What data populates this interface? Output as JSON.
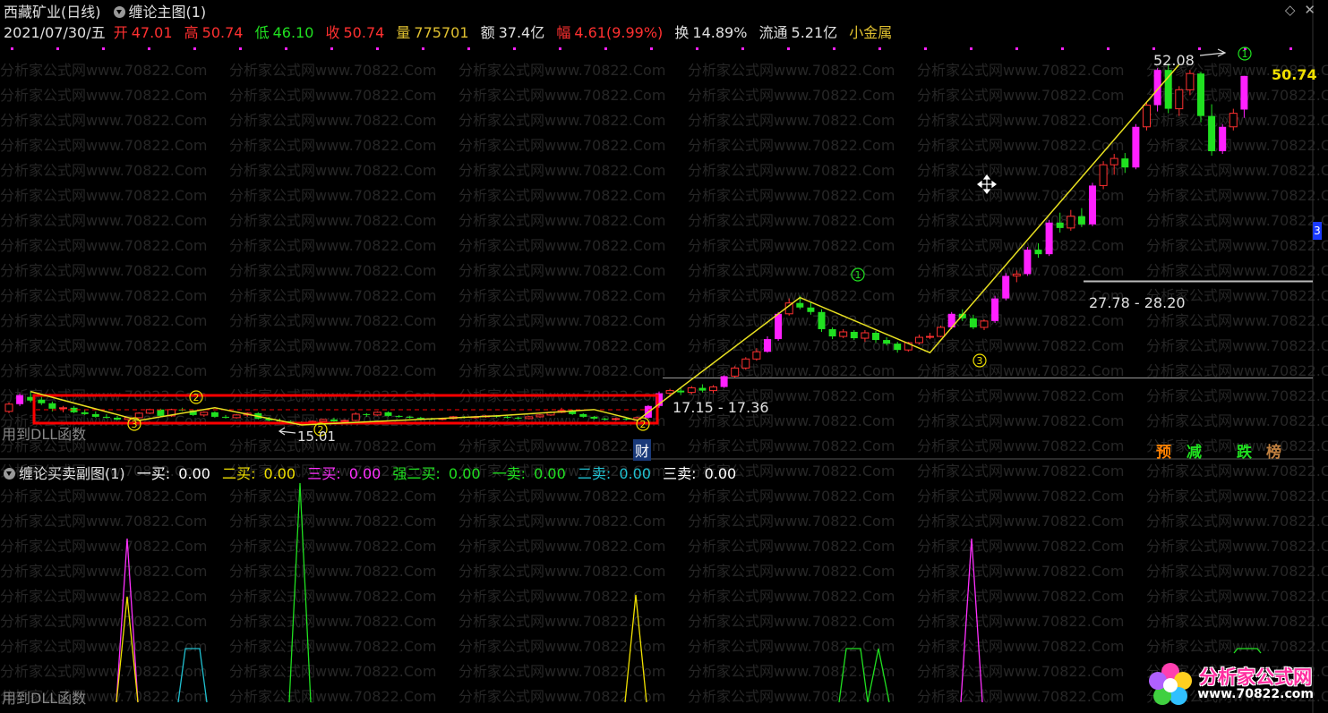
{
  "header": {
    "stock_name": "西藏矿业(日线)",
    "indicator_name": "缠论主图(1)",
    "date": "2021/07/30/五",
    "open_label": "开",
    "open": "47.01",
    "high_label": "高",
    "high": "50.74",
    "low_label": "低",
    "low": "46.10",
    "close_label": "收",
    "close": "50.74",
    "volume_label": "量",
    "volume": "775701",
    "amount_label": "额",
    "amount": "37.4亿",
    "change_label": "幅",
    "change": "4.61(9.99%)",
    "turnover_label": "换",
    "turnover": "14.89%",
    "float_label": "流通",
    "float": "5.21亿",
    "sector": "小金属"
  },
  "watermark_text": "分析家公式网www.70822.Com",
  "dll_notice": "用到DLL函数",
  "annotations": {
    "price_peak": "52.08",
    "price_last": "50.74",
    "range_upper": "27.78 - 28.20",
    "range_lower": "17.15 - 17.36",
    "price_low": "15.01",
    "cai_label": "财",
    "right_edge_marker": "3"
  },
  "bottom_tags": [
    {
      "label": "预",
      "color": "#ff8000"
    },
    {
      "label": "减",
      "color": "#20e020"
    },
    {
      "label": "跌",
      "color": "#20e020"
    },
    {
      "label": "榜",
      "color": "#c08040"
    }
  ],
  "sub_header": {
    "indicator_name": "缠论买卖副图(1)",
    "items": [
      {
        "label": "一买:",
        "value": "0.00",
        "color": "#ffffff"
      },
      {
        "label": "二买:",
        "value": "0.00",
        "color": "#f0e000"
      },
      {
        "label": "三买:",
        "value": "0.00",
        "color": "#ff30ff"
      },
      {
        "label": "强二买:",
        "value": "0.00",
        "color": "#20e020"
      },
      {
        "label": "一卖:",
        "value": "0.00",
        "color": "#20e020"
      },
      {
        "label": "二卖:",
        "value": "0.00",
        "color": "#20c0d0"
      },
      {
        "label": "三卖:",
        "value": "0.00",
        "color": "#ffffff"
      }
    ]
  },
  "logo": {
    "name": "分析家公式网",
    "url": "www.70822.com"
  },
  "colors": {
    "up": "#ff3030",
    "down": "#20e020",
    "magenta": "#ff20ff",
    "stroke_line": "#e8e020",
    "box": "#ff0000"
  },
  "chart_data": {
    "type": "candlestick",
    "symbol": "西藏矿业",
    "period": "日线",
    "candles": [
      [
        13.6,
        14.6,
        13.4,
        14.4
      ],
      [
        14.4,
        15.6,
        14.2,
        15.4
      ],
      [
        15.2,
        15.8,
        14.6,
        14.8
      ],
      [
        14.9,
        15.2,
        14.3,
        14.5
      ],
      [
        14.5,
        14.7,
        13.6,
        13.9
      ],
      [
        13.9,
        14.2,
        13.5,
        14.0
      ],
      [
        14.0,
        14.2,
        13.4,
        13.5
      ],
      [
        13.5,
        13.8,
        13.2,
        13.3
      ],
      [
        13.3,
        13.6,
        12.9,
        13.0
      ],
      [
        13.0,
        13.3,
        12.8,
        12.9
      ],
      [
        12.9,
        13.1,
        12.6,
        12.7
      ],
      [
        12.7,
        13.0,
        12.5,
        12.9
      ],
      [
        12.9,
        13.5,
        12.8,
        13.4
      ],
      [
        13.4,
        13.9,
        13.3,
        13.8
      ],
      [
        13.8,
        13.9,
        13.0,
        13.1
      ],
      [
        13.1,
        13.9,
        13.0,
        13.8
      ],
      [
        13.8,
        14.0,
        13.6,
        13.7
      ],
      [
        13.7,
        13.8,
        13.1,
        13.2
      ],
      [
        13.2,
        13.6,
        13.0,
        13.5
      ],
      [
        13.5,
        13.6,
        12.9,
        13.0
      ],
      [
        13.0,
        13.2,
        12.8,
        12.9
      ],
      [
        12.9,
        13.3,
        12.8,
        13.2
      ],
      [
        13.2,
        13.5,
        13.0,
        13.4
      ],
      [
        13.4,
        13.5,
        12.7,
        12.8
      ],
      [
        12.8,
        13.0,
        12.5,
        12.6
      ],
      [
        12.6,
        12.8,
        12.3,
        12.5
      ],
      [
        12.5,
        12.6,
        12.2,
        12.4
      ],
      [
        12.4,
        12.5,
        12.1,
        12.2
      ],
      [
        12.2,
        12.6,
        12.1,
        12.5
      ],
      [
        12.5,
        12.8,
        12.4,
        12.7
      ],
      [
        12.7,
        12.9,
        12.4,
        12.5
      ],
      [
        12.5,
        12.7,
        12.3,
        12.6
      ],
      [
        12.6,
        13.5,
        12.5,
        13.3
      ],
      [
        13.3,
        13.4,
        13.0,
        13.2
      ],
      [
        13.2,
        13.6,
        13.1,
        13.5
      ],
      [
        13.5,
        13.6,
        13.0,
        13.1
      ],
      [
        13.1,
        13.2,
        12.9,
        13.0
      ],
      [
        13.0,
        13.1,
        12.8,
        12.9
      ],
      [
        12.9,
        13.0,
        12.7,
        12.8
      ],
      [
        12.8,
        12.9,
        12.6,
        12.7
      ],
      [
        12.7,
        12.9,
        12.6,
        12.8
      ],
      [
        12.8,
        13.1,
        12.7,
        13.0
      ],
      [
        13.0,
        13.1,
        12.8,
        12.9
      ],
      [
        12.9,
        13.1,
        12.8,
        13.0
      ],
      [
        13.0,
        13.2,
        12.9,
        13.1
      ],
      [
        13.1,
        13.2,
        12.9,
        13.0
      ],
      [
        13.0,
        13.1,
        12.8,
        12.9
      ],
      [
        12.9,
        13.0,
        12.7,
        12.8
      ],
      [
        12.8,
        13.1,
        12.7,
        13.0
      ],
      [
        13.0,
        13.3,
        12.9,
        13.2
      ],
      [
        13.2,
        13.6,
        13.1,
        13.5
      ],
      [
        13.5,
        14.0,
        13.4,
        13.7
      ],
      [
        13.7,
        13.8,
        13.2,
        13.3
      ],
      [
        13.3,
        13.4,
        12.9,
        13.0
      ],
      [
        13.0,
        13.1,
        12.7,
        12.8
      ],
      [
        12.8,
        12.9,
        12.6,
        12.7
      ],
      [
        12.7,
        12.9,
        12.6,
        12.8
      ],
      [
        12.8,
        12.9,
        12.6,
        12.7
      ],
      [
        12.7,
        13.0,
        12.6,
        12.9
      ],
      [
        12.9,
        14.3,
        12.8,
        14.2
      ],
      [
        14.2,
        15.8,
        14.0,
        15.6
      ],
      [
        15.6,
        16.1,
        15.2,
        15.9
      ],
      [
        15.9,
        16.3,
        15.4,
        15.7
      ],
      [
        15.7,
        16.4,
        15.5,
        16.2
      ],
      [
        16.2,
        16.6,
        15.7,
        15.9
      ],
      [
        15.9,
        16.5,
        15.6,
        16.3
      ],
      [
        16.3,
        17.6,
        16.2,
        17.5
      ],
      [
        17.5,
        18.6,
        17.3,
        18.4
      ],
      [
        18.4,
        19.6,
        18.2,
        19.4
      ],
      [
        19.4,
        20.6,
        19.2,
        20.2
      ],
      [
        20.2,
        21.9,
        20.1,
        21.6
      ],
      [
        21.6,
        24.6,
        21.4,
        24.4
      ],
      [
        24.4,
        26.1,
        24.2,
        25.6
      ],
      [
        25.6,
        26.4,
        24.9,
        25.1
      ],
      [
        25.1,
        25.7,
        24.3,
        24.6
      ],
      [
        24.6,
        24.9,
        22.4,
        22.7
      ],
      [
        22.7,
        22.9,
        21.6,
        21.9
      ],
      [
        21.9,
        22.7,
        21.7,
        22.4
      ],
      [
        22.4,
        22.6,
        21.5,
        21.7
      ],
      [
        21.7,
        22.6,
        21.3,
        22.3
      ],
      [
        22.3,
        22.5,
        21.2,
        21.5
      ],
      [
        21.5,
        21.8,
        20.9,
        21.1
      ],
      [
        21.1,
        21.3,
        20.1,
        20.4
      ],
      [
        20.4,
        21.3,
        20.2,
        21.2
      ],
      [
        21.2,
        22.1,
        21.0,
        21.8
      ],
      [
        21.8,
        22.3,
        21.6,
        21.9
      ],
      [
        21.9,
        23.1,
        21.8,
        22.9
      ],
      [
        22.9,
        24.6,
        22.7,
        24.4
      ],
      [
        24.4,
        24.9,
        23.6,
        23.9
      ],
      [
        23.9,
        24.3,
        22.7,
        22.9
      ],
      [
        22.9,
        23.8,
        22.6,
        23.6
      ],
      [
        23.6,
        26.4,
        23.4,
        26.1
      ],
      [
        26.1,
        28.9,
        25.9,
        28.6
      ],
      [
        28.6,
        29.2,
        27.9,
        28.8
      ],
      [
        28.8,
        31.8,
        28.6,
        31.5
      ],
      [
        31.5,
        32.2,
        30.6,
        31.0
      ],
      [
        31.0,
        34.8,
        30.8,
        34.5
      ],
      [
        34.5,
        35.6,
        33.4,
        33.9
      ],
      [
        33.9,
        35.9,
        33.6,
        35.2
      ],
      [
        35.2,
        36.1,
        34.0,
        34.3
      ],
      [
        34.3,
        38.9,
        34.1,
        38.6
      ],
      [
        38.6,
        41.3,
        38.2,
        40.9
      ],
      [
        40.9,
        42.1,
        39.8,
        41.6
      ],
      [
        41.6,
        42.2,
        40.0,
        40.6
      ],
      [
        40.6,
        45.4,
        40.4,
        45.1
      ],
      [
        45.1,
        47.8,
        44.7,
        47.5
      ],
      [
        47.5,
        51.6,
        46.8,
        51.4
      ],
      [
        51.4,
        52.1,
        46.6,
        47.1
      ],
      [
        47.1,
        49.6,
        46.3,
        49.2
      ],
      [
        49.2,
        51.4,
        48.6,
        51.0
      ],
      [
        51.0,
        51.2,
        45.6,
        46.3
      ],
      [
        46.3,
        47.6,
        41.9,
        42.4
      ],
      [
        42.4,
        45.4,
        42.1,
        45.1
      ],
      [
        45.1,
        47.1,
        44.7,
        46.6
      ],
      [
        47.01,
        50.74,
        46.1,
        50.74
      ]
    ],
    "ylim": [
      12,
      53
    ]
  }
}
